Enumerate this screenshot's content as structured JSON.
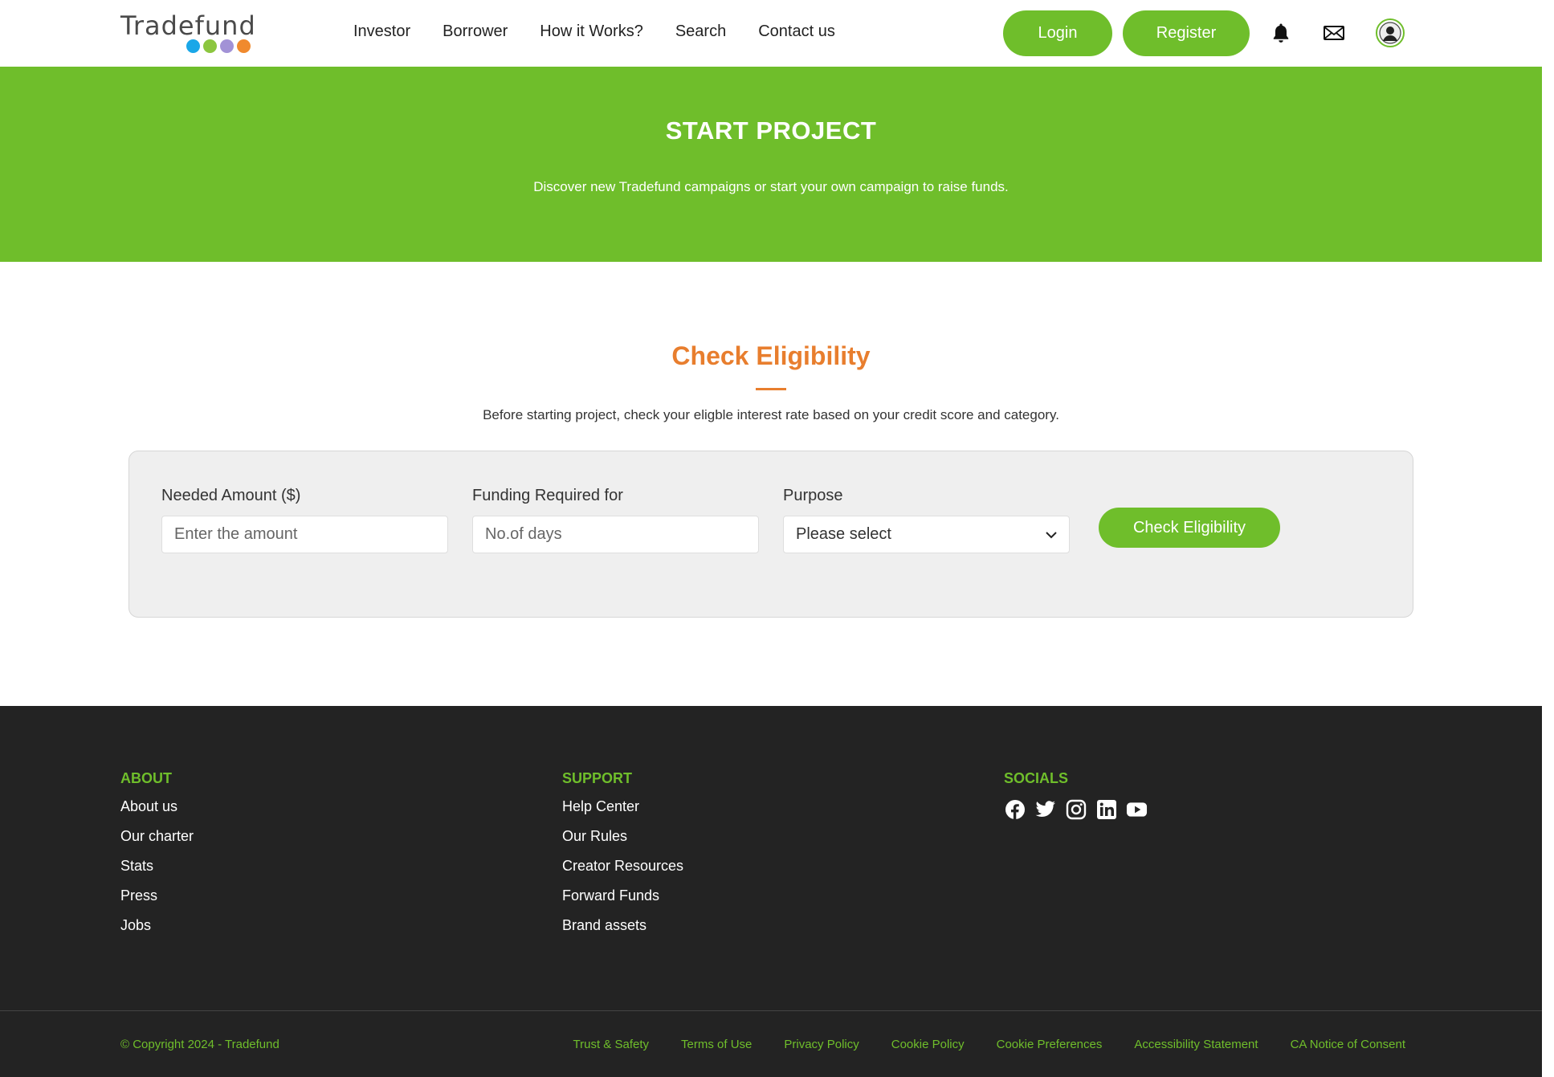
{
  "brand": {
    "name": "Tradefund",
    "dot_colors": [
      "#1aa7e8",
      "#8cc63f",
      "#a292d6",
      "#f08a2e"
    ]
  },
  "colors": {
    "green": "#6fbe2b",
    "orange": "#e87e2e",
    "footer_bg": "#232323"
  },
  "nav": {
    "items": [
      "Investor",
      "Borrower",
      "How it Works?",
      "Search",
      "Contact us"
    ]
  },
  "header": {
    "login_label": "Login",
    "register_label": "Register",
    "icons": [
      "bell-icon",
      "mail-icon",
      "user-avatar-icon"
    ]
  },
  "hero": {
    "title": "START PROJECT",
    "subtitle": "Discover new Tradefund campaigns or start your own campaign to raise funds."
  },
  "eligibility": {
    "title": "Check Eligibility",
    "subtitle": "Before starting project, check your eligble interest rate based on your credit score and category.",
    "fields": {
      "amount": {
        "label": "Needed Amount ($)",
        "placeholder": "Enter the amount",
        "value": ""
      },
      "days": {
        "label": "Funding Required for",
        "placeholder": "No.of days",
        "value": ""
      },
      "purpose": {
        "label": "Purpose",
        "selected": "Please select"
      }
    },
    "button_label": "Check Eligibility"
  },
  "footer": {
    "about": {
      "heading": "ABOUT",
      "links": [
        "About us",
        "Our charter",
        "Stats",
        "Press",
        "Jobs"
      ]
    },
    "support": {
      "heading": "SUPPORT",
      "links": [
        "Help Center",
        "Our Rules",
        "Creator Resources",
        "Forward Funds",
        "Brand assets"
      ]
    },
    "socials": {
      "heading": "SOCIALS",
      "icons": [
        "facebook-icon",
        "twitter-icon",
        "instagram-icon",
        "linkedin-icon",
        "youtube-icon"
      ]
    },
    "copyright": "© Copyright 2024 - Tradefund",
    "legal_links": [
      "Trust & Safety",
      "Terms of Use",
      "Privacy Policy",
      "Cookie Policy",
      "Cookie Preferences",
      "Accessibility Statement",
      "CA Notice of Consent"
    ]
  }
}
